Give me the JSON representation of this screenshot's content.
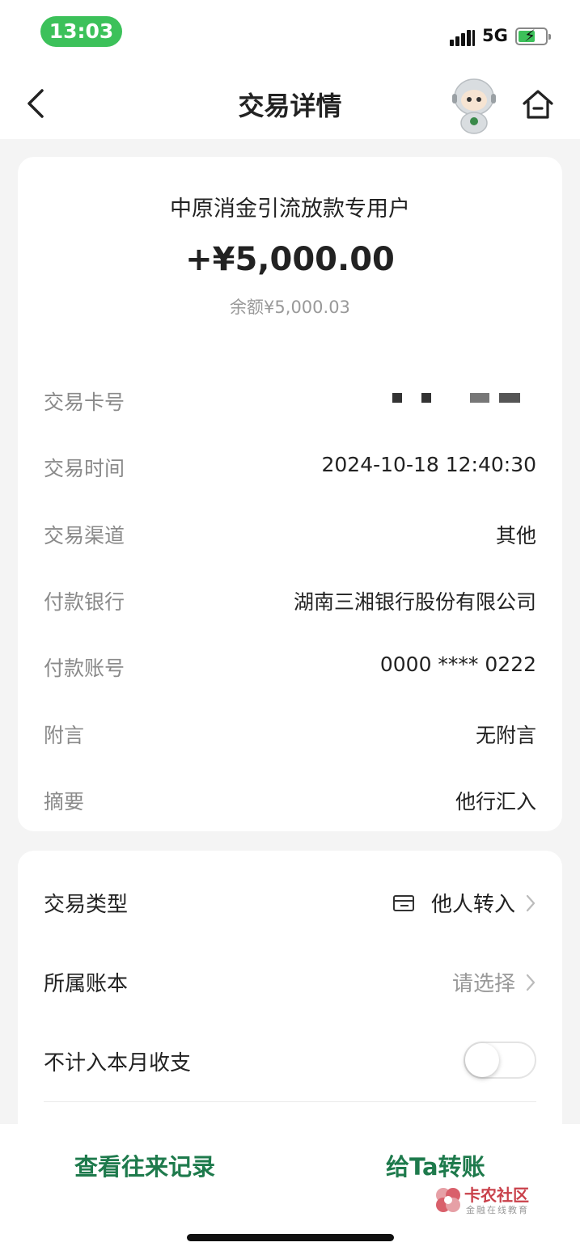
{
  "status_bar": {
    "time": "13:03",
    "network": "5G"
  },
  "nav": {
    "title": "交易详情"
  },
  "summary": {
    "payer": "中原消金引流放款专用户",
    "amount": "+¥5,000.00",
    "balance": "余额¥5,000.03"
  },
  "details": [
    {
      "label": "交易卡号",
      "value": ""
    },
    {
      "label": "交易时间",
      "value": "2024-10-18 12:40:30"
    },
    {
      "label": "交易渠道",
      "value": "其他"
    },
    {
      "label": "付款银行",
      "value": "湖南三湘银行股份有限公司"
    },
    {
      "label": "付款账号",
      "value": "0000 **** 0222"
    },
    {
      "label": "附言",
      "value": "无附言"
    },
    {
      "label": "摘要",
      "value": "他行汇入"
    }
  ],
  "settings": {
    "type": {
      "label": "交易类型",
      "value": "他人转入"
    },
    "book": {
      "label": "所属账本",
      "value": "请选择"
    },
    "exclude": {
      "label": "不计入本月收支",
      "enabled": false
    }
  },
  "bottom": {
    "history_label": "查看往来记录",
    "transfer_label": "给Ta转账"
  },
  "watermark": {
    "name": "卡农社区",
    "tagline": "金融在线教育"
  },
  "colors": {
    "accent": "#1e7a4c",
    "status_green": "#3cc15a",
    "label_gray": "#8a8a8a"
  }
}
